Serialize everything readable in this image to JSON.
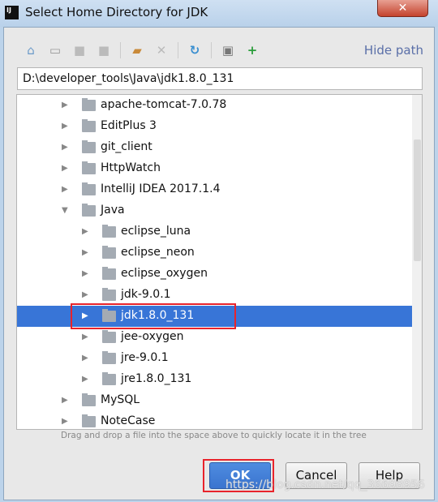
{
  "window": {
    "title": "Select Home Directory for JDK",
    "app_icon": "IJ",
    "close": "✕"
  },
  "toolbar": {
    "icons": [
      "home-icon",
      "desktop-icon",
      "project-icon",
      "module-icon",
      "new-folder-icon",
      "delete-icon",
      "refresh-icon",
      "show-hidden-icon",
      "add-jdk-icon"
    ],
    "hide_path": "Hide path"
  },
  "path": "D:\\developer_tools\\Java\\jdk1.8.0_131",
  "tree": [
    {
      "label": "apache-tomcat-7.0.78",
      "level": 1,
      "expanded": false
    },
    {
      "label": "EditPlus 3",
      "level": 1,
      "expanded": false
    },
    {
      "label": "git_client",
      "level": 1,
      "expanded": false
    },
    {
      "label": "HttpWatch",
      "level": 1,
      "expanded": false
    },
    {
      "label": "IntelliJ IDEA 2017.1.4",
      "level": 1,
      "expanded": false
    },
    {
      "label": "Java",
      "level": 1,
      "expanded": true
    },
    {
      "label": "eclipse_luna",
      "level": 2,
      "expanded": false
    },
    {
      "label": "eclipse_neon",
      "level": 2,
      "expanded": false
    },
    {
      "label": "eclipse_oxygen",
      "level": 2,
      "expanded": false
    },
    {
      "label": "jdk-9.0.1",
      "level": 2,
      "expanded": false
    },
    {
      "label": "jdk1.8.0_131",
      "level": 2,
      "expanded": false,
      "selected": true
    },
    {
      "label": "jee-oxygen",
      "level": 2,
      "expanded": false
    },
    {
      "label": "jre-9.0.1",
      "level": 2,
      "expanded": false
    },
    {
      "label": "jre1.8.0_131",
      "level": 2,
      "expanded": false
    },
    {
      "label": "MySQL",
      "level": 1,
      "expanded": false
    },
    {
      "label": "NoteCase",
      "level": 1,
      "expanded": false
    }
  ],
  "hint": "Drag and drop a file into the space above to quickly locate it in the tree",
  "buttons": {
    "ok": "OK",
    "cancel": "Cancel",
    "help": "Help"
  },
  "watermark": "https://blog.csdn.net/qq_36698956",
  "colors": {
    "selection": "#3875d7",
    "highlight": "#e8232b"
  }
}
